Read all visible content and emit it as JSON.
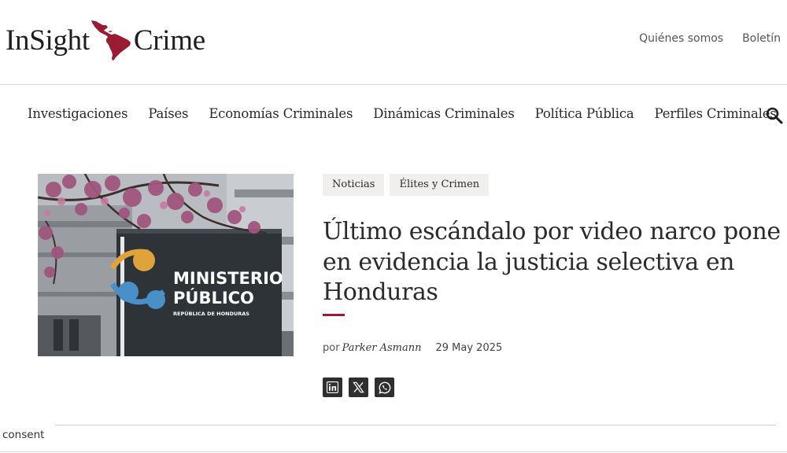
{
  "brand": {
    "name_left": "InSight",
    "name_right": "Crime",
    "logo_icon": "latin-america-map-icon",
    "accent_color": "#9b1b30"
  },
  "top_links": [
    {
      "label": "Quiénes somos"
    },
    {
      "label": "Boletín"
    }
  ],
  "nav": {
    "items": [
      {
        "label": "Investigaciones"
      },
      {
        "label": "Países"
      },
      {
        "label": "Economías Criminales"
      },
      {
        "label": "Dinámicas Criminales"
      },
      {
        "label": "Política Pública"
      },
      {
        "label": "Perfiles Criminales"
      }
    ],
    "search_icon": "search-icon"
  },
  "article": {
    "tags": [
      {
        "label": "Noticias"
      },
      {
        "label": "Élites y Crimen"
      }
    ],
    "headline": "Último escándalo por video narco pone en evidencia la justicia selectiva en Honduras",
    "byline_prefix": "por",
    "author": "Parker Asmann",
    "date": "29 May 2025",
    "image": {
      "sign_line1": "MINISTERIO",
      "sign_line2": "PÚBLICO",
      "sign_line3": "REPÚBLICA DE HONDURAS"
    },
    "share_icons": [
      "linkedin-icon",
      "x-icon",
      "whatsapp-icon"
    ]
  },
  "consent": {
    "label": "consent"
  }
}
